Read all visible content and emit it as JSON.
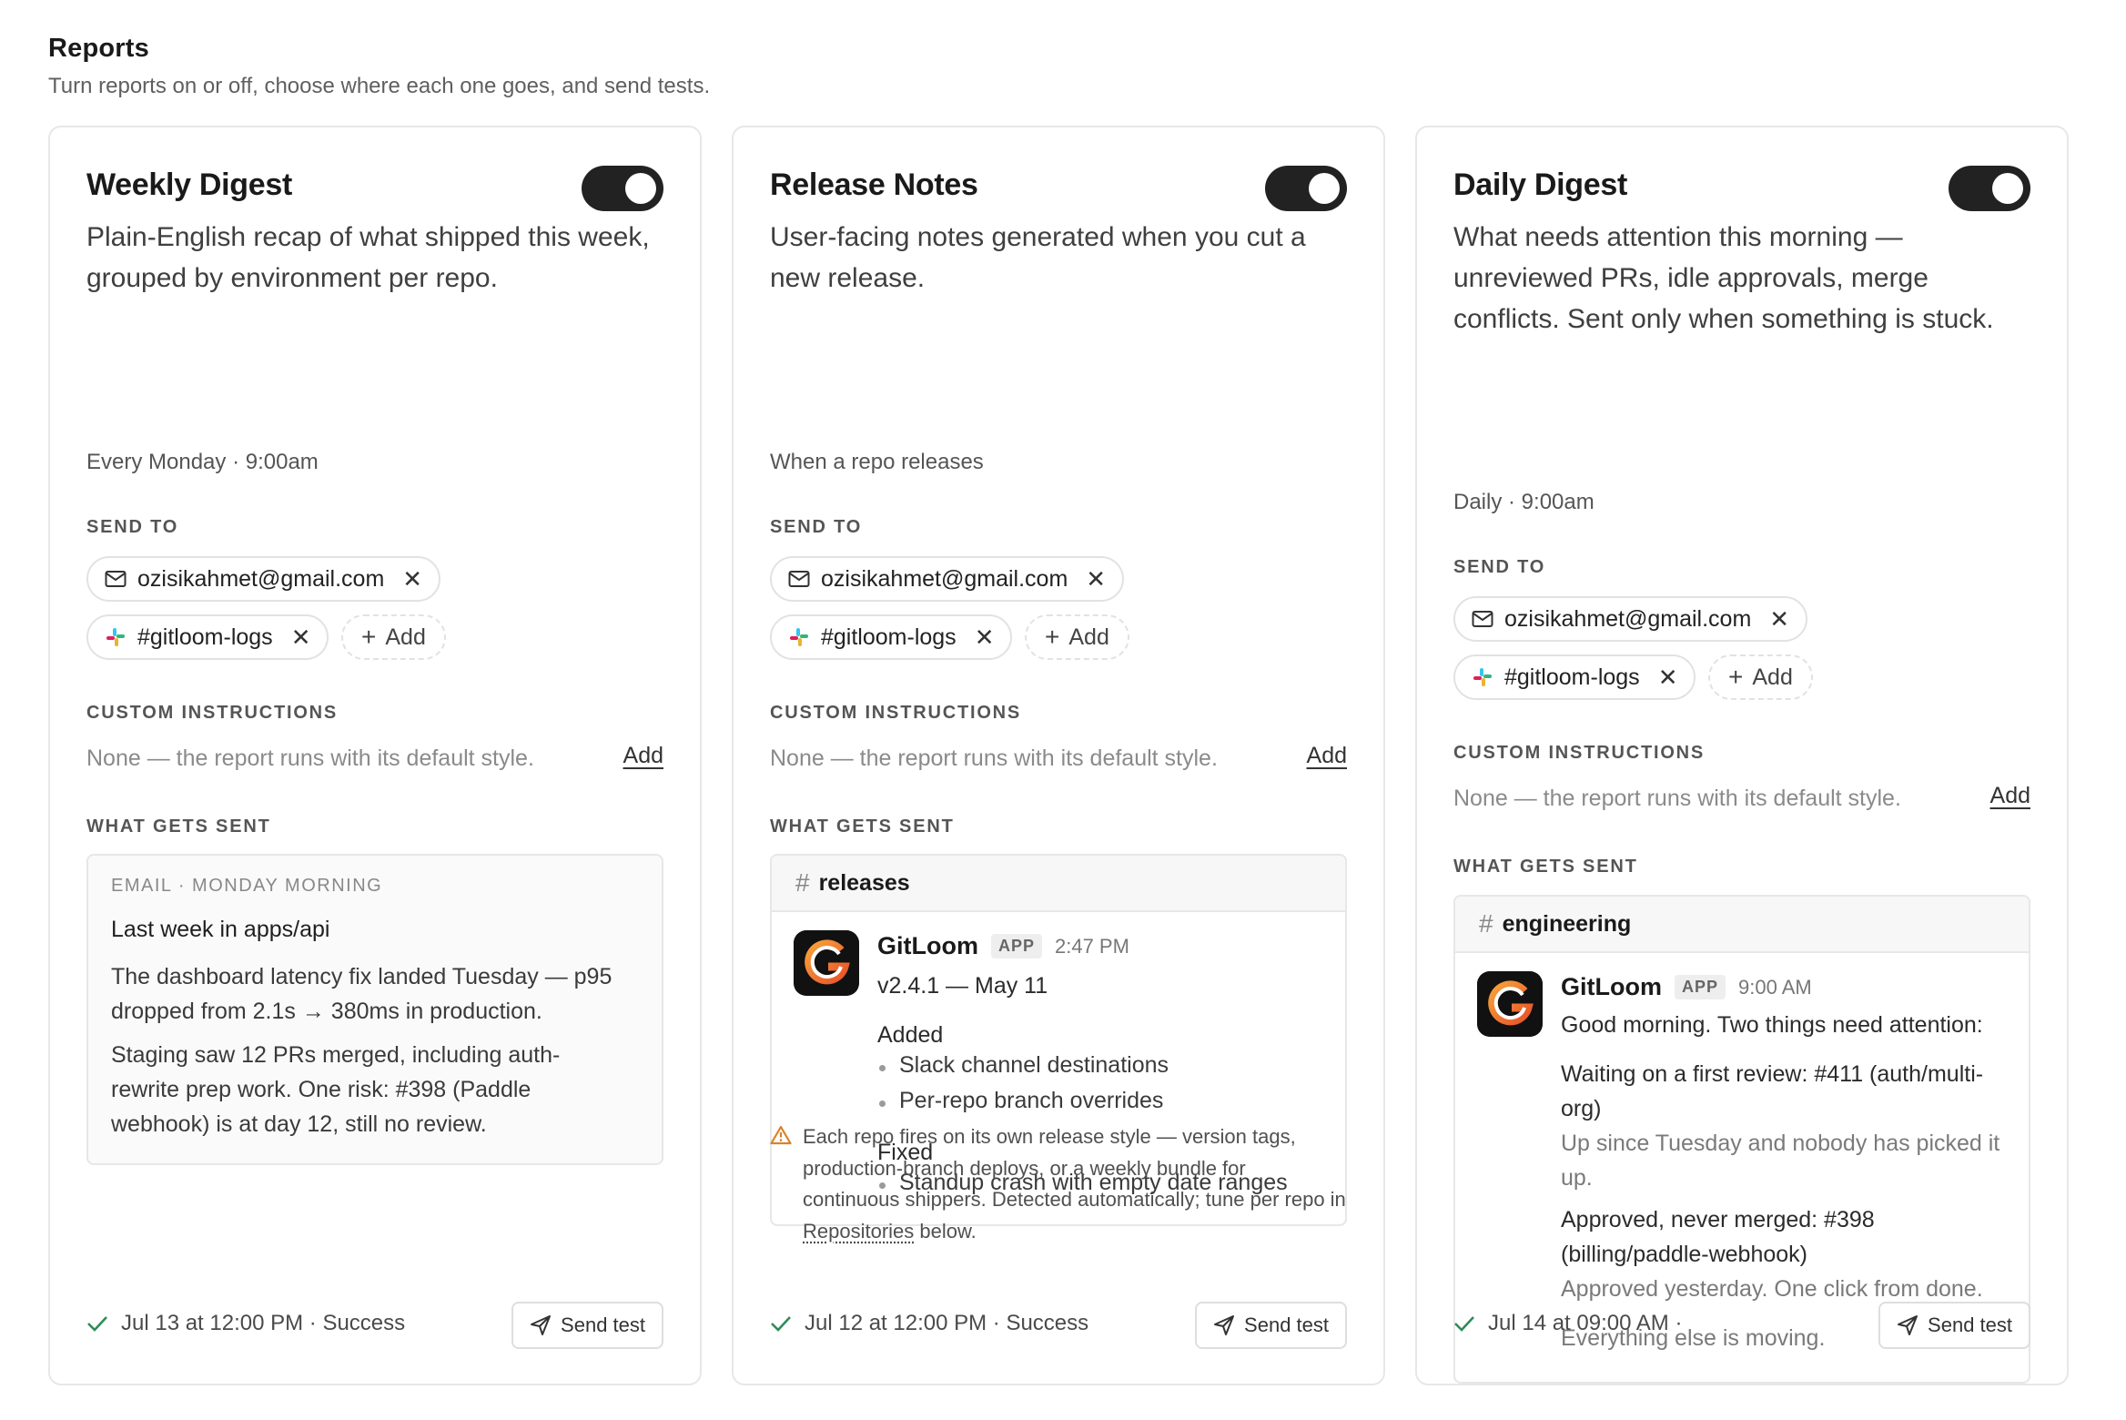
{
  "page": {
    "title": "Reports",
    "subtitle": "Turn reports on or off, choose where each one goes, and send tests."
  },
  "labels": {
    "send_to": "SEND TO",
    "custom_instructions": "CUSTOM INSTRUCTIONS",
    "what_gets_sent": "WHAT GETS SENT",
    "add_chip": "Add",
    "ci_add": "Add",
    "send_test": "Send test",
    "app_badge": "APP"
  },
  "colors": {
    "toggle_on": "#222222",
    "success": "#2e8b57",
    "warning": "#d9822b"
  },
  "cards": [
    {
      "title": "Weekly Digest",
      "enabled": true,
      "description": "Plain-English recap of what shipped this week, grouped by environment per repo.",
      "schedule": "Every Monday · 9:00am",
      "recipients": {
        "email": "ozisikahmet@gmail.com",
        "slack": "#gitloom-logs"
      },
      "custom_instructions": "None — the report runs with its default style.",
      "preview": {
        "meta": "EMAIL · MONDAY MORNING",
        "heading": "Last week in apps/api",
        "p1": "The dashboard latency fix landed Tuesday — p95 dropped from 2.1s → 380ms in production.",
        "p2": "Staging saw 12 PRs merged, including auth-rewrite prep work. One risk: #398 (Paddle webhook) is at day 12, still no review."
      },
      "last_run": "Jul 13 at 12:00 PM · Success"
    },
    {
      "title": "Release Notes",
      "enabled": true,
      "description": "User-facing notes generated when you cut a new release.",
      "schedule": "When a repo releases",
      "recipients": {
        "email": "ozisikahmet@gmail.com",
        "slack": "#gitloom-logs"
      },
      "custom_instructions": "None — the report runs with its default style.",
      "preview": {
        "channel": "releases",
        "bot": "GitLoom",
        "time": "2:47 PM",
        "version": "v2.4.1 — May 11",
        "added_label": "Added",
        "added": [
          "Slack channel destinations",
          "Per-repo branch overrides"
        ],
        "fixed_label": "Fixed",
        "fixed": [
          "Standup crash with empty date ranges"
        ]
      },
      "note": {
        "before": "Each repo fires on its own release style — version tags, production-branch deploys, or a weekly bundle for continuous shippers. Detected automatically; tune per repo in ",
        "link": "Repositories",
        "after": " below."
      },
      "last_run": "Jul 12 at 12:00 PM · Success"
    },
    {
      "title": "Daily Digest",
      "enabled": true,
      "description": "What needs attention this morning — unreviewed PRs, idle approvals, merge conflicts. Sent only when something is stuck.",
      "schedule": "Daily · 9:00am",
      "recipients": {
        "email": "ozisikahmet@gmail.com",
        "slack": "#gitloom-logs"
      },
      "custom_instructions": "None — the report runs with its default style.",
      "preview": {
        "channel": "engineering",
        "bot": "GitLoom",
        "time": "9:00 AM",
        "intro": "Good morning. Two things need attention:",
        "item1": "Waiting on a first review: #411 (auth/multi-org)",
        "item1_note": "Up since Tuesday and nobody has picked it up.",
        "item2": "Approved, never merged: #398 (billing/paddle-webhook)",
        "item2_note": "Approved yesterday. One click from done.",
        "outro": "Everything else is moving."
      },
      "last_run": "Jul 14 at 09:00 AM ·"
    }
  ]
}
